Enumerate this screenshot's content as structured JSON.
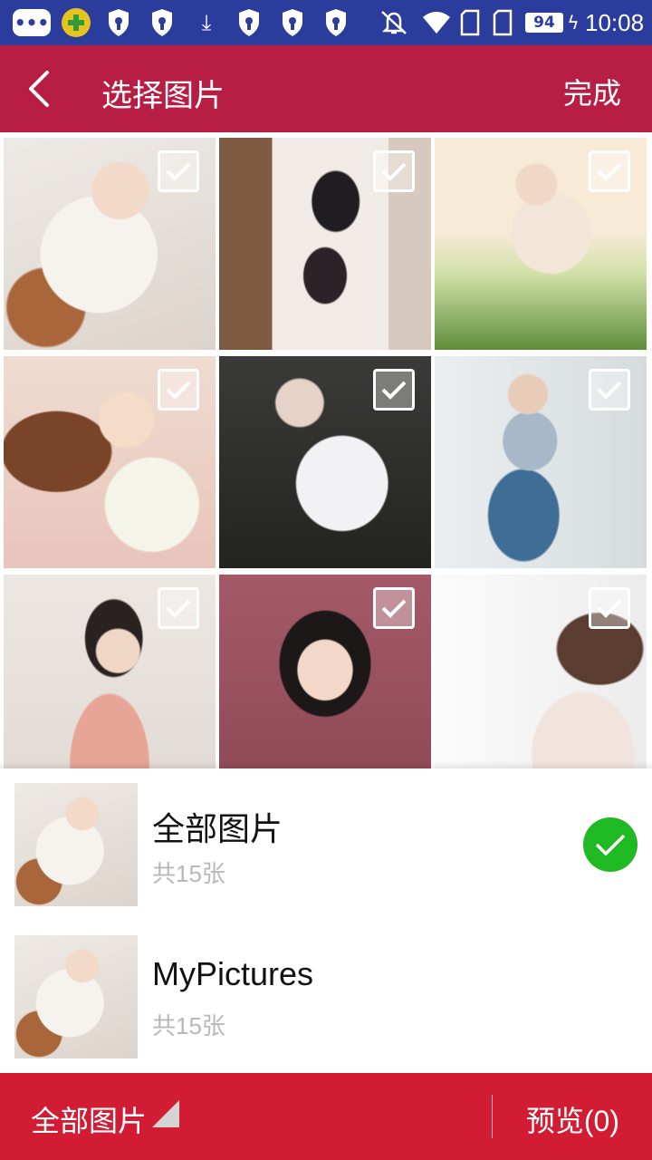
{
  "status_bar": {
    "battery": "94",
    "time": "10:08",
    "icons": [
      "message-icon",
      "security-plus-icon",
      "shield-icon",
      "shield-icon",
      "download-icon",
      "shield-icon",
      "shield-icon",
      "shield-icon",
      "alarm-off-icon",
      "wifi-icon",
      "sim-icon",
      "sim-icon",
      "battery-icon",
      "charging-icon"
    ],
    "bar_color": "#2a3c9c"
  },
  "header": {
    "title": "选择图片",
    "done_label": "完成",
    "back_icon": "chevron-left-icon",
    "bar_color": "#b81d44"
  },
  "grid": {
    "photos": [
      {
        "checked": false
      },
      {
        "checked": false
      },
      {
        "checked": false
      },
      {
        "checked": false
      },
      {
        "checked": false
      },
      {
        "checked": false
      },
      {
        "checked": false
      },
      {
        "checked": false
      },
      {
        "checked": false
      }
    ]
  },
  "folders": [
    {
      "name": "全部图片",
      "count": "共15张",
      "selected": true
    },
    {
      "name": "MyPictures",
      "count": "共15张",
      "selected": false
    }
  ],
  "footer": {
    "album_label": "全部图片",
    "preview_label": "预览(0)",
    "bar_color": "#d11c34",
    "selected_color": "#1fb923"
  }
}
